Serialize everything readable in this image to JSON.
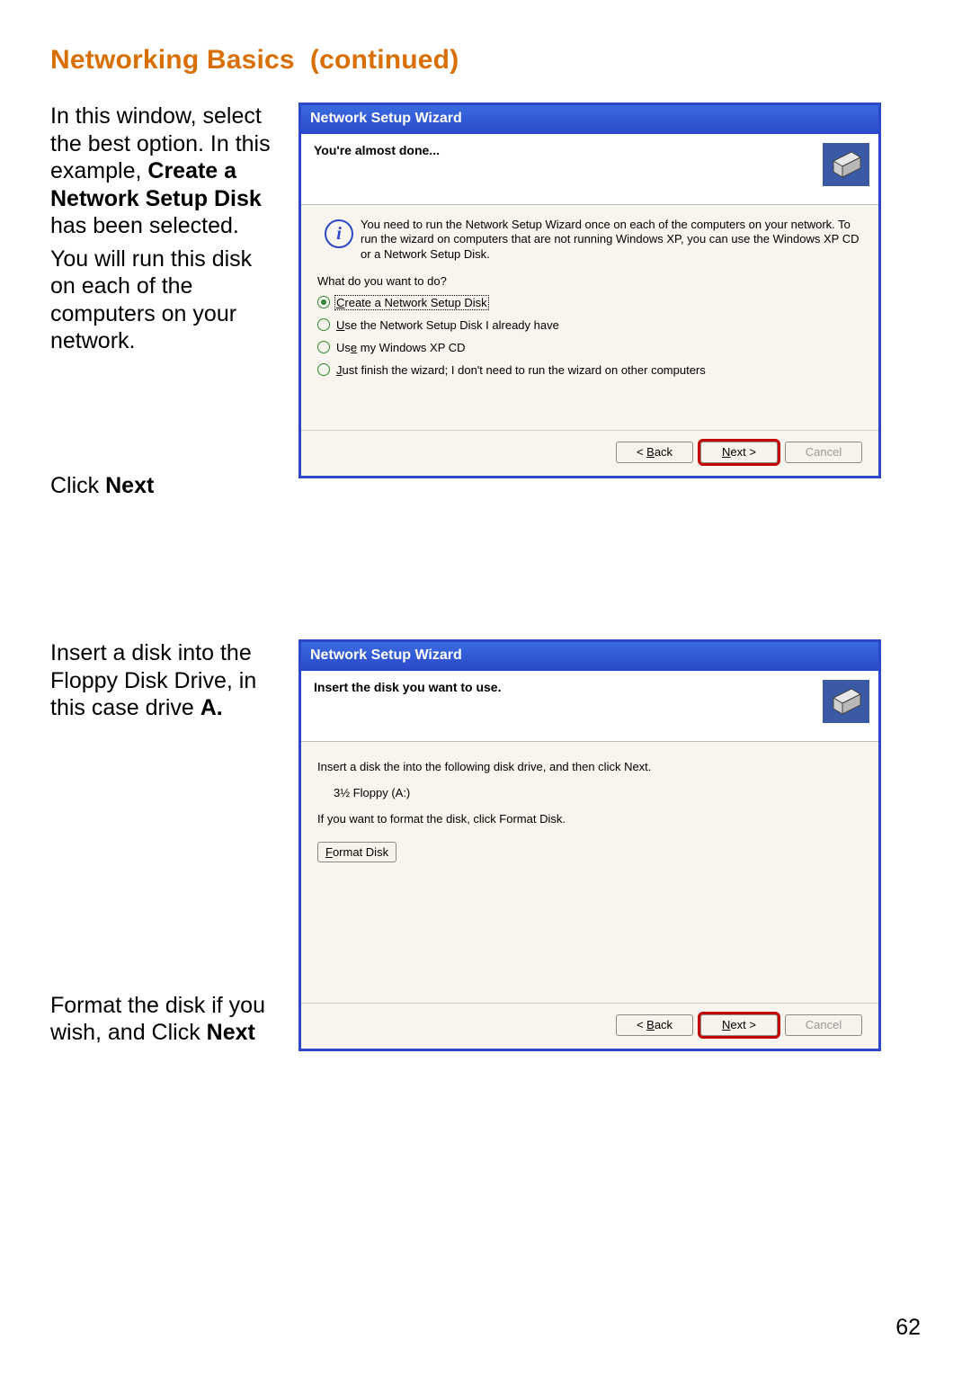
{
  "heading": "Networking Basics  (continued)",
  "page_number": "62",
  "section1": {
    "side": {
      "p1_a": "In this window, select the best option.  In this example, ",
      "p1_bold": "Create a Network Setup Disk",
      "p1_b": " has been selected.",
      "p2": "You will run this disk on each of the computers on your network.",
      "p3_a": "Click ",
      "p3_bold": "Next"
    },
    "wizard": {
      "title": "Network Setup Wizard",
      "header": "You're almost done...",
      "info": "You need to run the Network Setup Wizard once on each of the computers on your network. To run the wizard on computers that are not running Windows XP, you can use the Windows XP CD or a Network Setup Disk.",
      "question": "What do you want to do?",
      "options": [
        {
          "underline": "C",
          "rest": "reate a Network Setup Disk",
          "selected": true
        },
        {
          "underline": "U",
          "rest": "se the Network Setup Disk I already have",
          "selected": false
        },
        {
          "pre": "Us",
          "underline": "e",
          "rest": " my Windows XP CD",
          "selected": false
        },
        {
          "underline": "J",
          "rest": "ust finish the wizard; I don't need to run the wizard on other computers",
          "selected": false
        }
      ],
      "buttons": {
        "back_lt": "< ",
        "back_u": "B",
        "back_rest": "ack",
        "next_u": "N",
        "next_rest": "ext >",
        "cancel": "Cancel"
      }
    }
  },
  "section2": {
    "side": {
      "p1_a": "Insert a disk into the Floppy Disk Drive, in this case drive ",
      "p1_bold": "A.",
      "p2_a": "Format the disk if you wish, and Click ",
      "p2_bold": "Next"
    },
    "wizard": {
      "title": "Network Setup Wizard",
      "header": "Insert the disk you want to use.",
      "line1": "Insert a disk the into the following disk drive, and then click Next.",
      "drive": "3½ Floppy (A:)",
      "line2": "If you want to format the disk, click Format Disk.",
      "format_u": "F",
      "format_rest": "ormat Disk",
      "buttons": {
        "back_lt": "< ",
        "back_u": "B",
        "back_rest": "ack",
        "next_u": "N",
        "next_rest": "ext >",
        "cancel": "Cancel"
      }
    }
  }
}
